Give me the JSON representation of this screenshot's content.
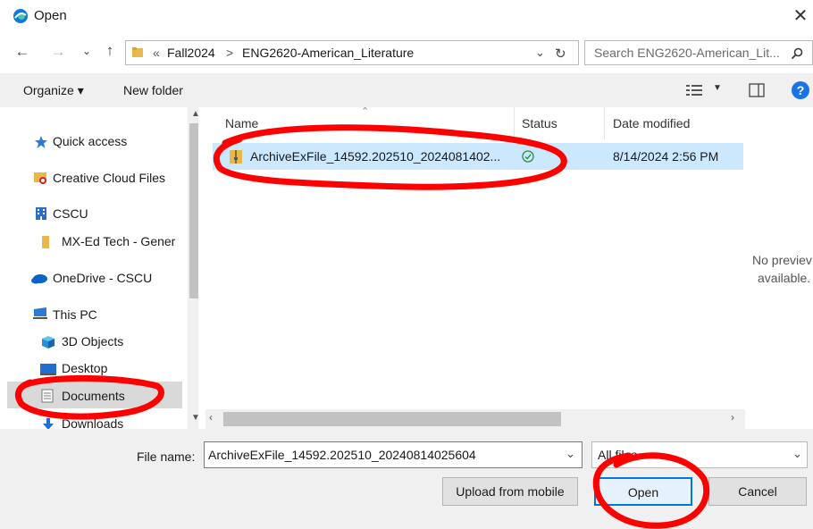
{
  "window": {
    "title": "Open",
    "icon": "edge-browser-icon"
  },
  "address_bar": {
    "overflow": "«",
    "path": [
      "Fall2024",
      "ENG2620-American_Literature"
    ],
    "separator": ">"
  },
  "search": {
    "placeholder": "Search ENG2620-American_Lit..."
  },
  "toolbar": {
    "organize_label": "Organize ▾",
    "new_folder_label": "New folder",
    "help_label": "?"
  },
  "navigation": {
    "items": [
      {
        "label": "Quick access",
        "icon": "star-icon"
      },
      {
        "label": "Creative Cloud Files",
        "icon": "creative-cloud-icon"
      },
      {
        "label": "CSCU",
        "icon": "building-icon"
      },
      {
        "label": "MX-Ed Tech - Gener",
        "icon": "folder-icon"
      },
      {
        "label": "OneDrive - CSCU",
        "icon": "cloud-icon"
      },
      {
        "label": "This PC",
        "icon": "computer-icon"
      },
      {
        "label": "3D Objects",
        "icon": "cube-icon"
      },
      {
        "label": "Desktop",
        "icon": "desktop-icon"
      },
      {
        "label": "Documents",
        "icon": "document-icon"
      },
      {
        "label": "Downloads",
        "icon": "download-icon"
      }
    ]
  },
  "file_list": {
    "columns": [
      "Name",
      "Status",
      "Date modified"
    ],
    "rows": [
      {
        "name": "ArchiveExFile_14592.202510_2024081402...",
        "status": "synced",
        "date_modified": "8/14/2024 2:56 PM"
      }
    ]
  },
  "preview": {
    "line1": "No previev",
    "line2": "available."
  },
  "footer": {
    "file_name_label": "File name:",
    "file_name_value": "ArchiveExFile_14592.202510_20240814025604",
    "file_type_value": "All files",
    "upload_label": "Upload from mobile",
    "open_label": "Open",
    "cancel_label": "Cancel"
  },
  "colors": {
    "accent": "#1a73e8",
    "selection": "#cce8ff",
    "annotation": "#ff0000",
    "sync_ok": "#2e8b3a"
  }
}
